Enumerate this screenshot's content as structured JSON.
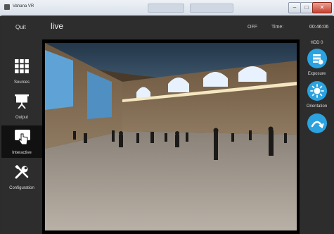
{
  "window": {
    "title": "Vahana VR",
    "controls": {
      "minimize": "–",
      "maximize": "□",
      "close": "✕"
    }
  },
  "header": {
    "quit_label": "Quit",
    "mode_label": "live",
    "rec_state": "OFF",
    "time_label": "Time:",
    "time_value": "00:46:06"
  },
  "nav": {
    "items": [
      {
        "label": "Sources",
        "icon": "grid-icon"
      },
      {
        "label": "Output",
        "icon": "projector-screen-icon"
      },
      {
        "label": "Interactive",
        "icon": "hand-pointer-icon",
        "active": true
      },
      {
        "label": "Configuration",
        "icon": "tools-icon"
      }
    ]
  },
  "right_panel": {
    "hdd_label": "HDD 0",
    "buttons": [
      {
        "label": "Exposure",
        "icon": "exposure-settings-icon"
      },
      {
        "label": "Orientation",
        "icon": "sun-icon"
      },
      {
        "label": "",
        "icon": "rotate-arc-icon"
      }
    ]
  },
  "colors": {
    "accent": "#2aa3e0",
    "background": "#2c2c2c",
    "active_nav": "#111111"
  }
}
